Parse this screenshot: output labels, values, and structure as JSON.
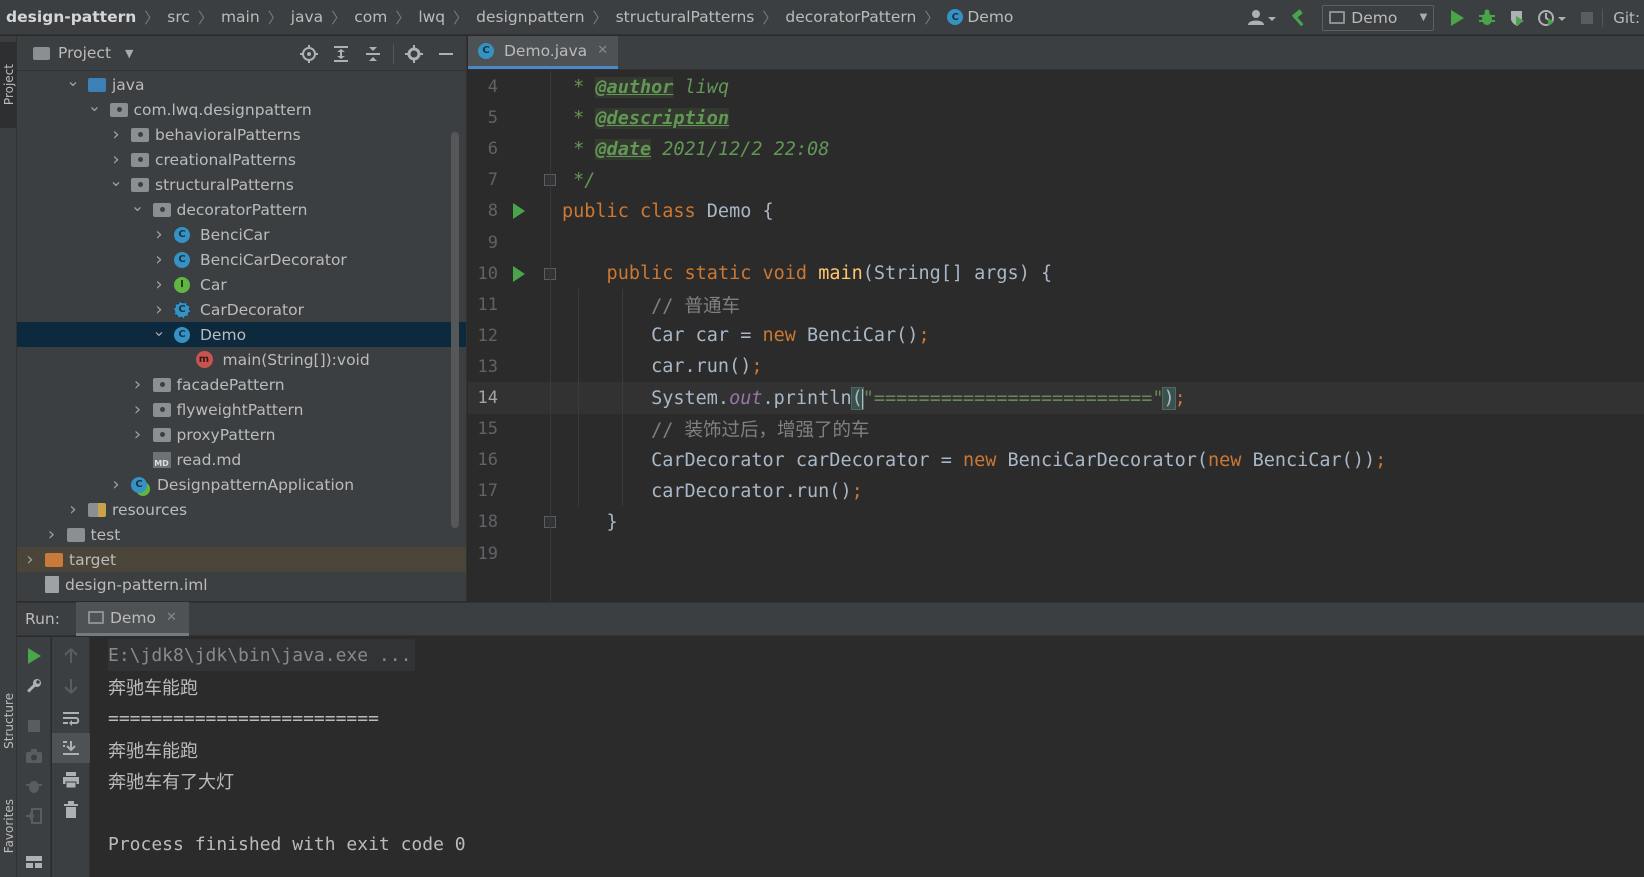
{
  "breadcrumb": [
    {
      "label": "design-pattern"
    },
    {
      "label": "src"
    },
    {
      "label": "main"
    },
    {
      "label": "java"
    },
    {
      "label": "com"
    },
    {
      "label": "lwq"
    },
    {
      "label": "designpattern"
    },
    {
      "label": "structuralPatterns"
    },
    {
      "label": "decoratorPattern"
    },
    {
      "label": "Demo"
    }
  ],
  "toolbar": {
    "run_config": "Demo",
    "git_label": "Git:"
  },
  "left_stripe": {
    "project": "Project",
    "structure": "Structure",
    "favorites": "Favorites"
  },
  "project_panel": {
    "title": "Project",
    "tree": [
      {
        "label": "java",
        "depth": 3,
        "expanded": true,
        "icon": "folder-blue-icon"
      },
      {
        "label": "com.lwq.designpattern",
        "depth": 4,
        "expanded": true,
        "icon": "package-icon"
      },
      {
        "label": "behavioralPatterns",
        "depth": 5,
        "expanded": false,
        "icon": "package-icon"
      },
      {
        "label": "creationalPatterns",
        "depth": 5,
        "expanded": false,
        "icon": "package-icon"
      },
      {
        "label": "structuralPatterns",
        "depth": 5,
        "expanded": true,
        "icon": "package-icon"
      },
      {
        "label": "decoratorPattern",
        "depth": 6,
        "expanded": true,
        "icon": "package-icon"
      },
      {
        "label": "BenciCar",
        "depth": 7,
        "expanded": false,
        "icon": "class-icon"
      },
      {
        "label": "BenciCarDecorator",
        "depth": 7,
        "expanded": false,
        "icon": "class-icon"
      },
      {
        "label": "Car",
        "depth": 7,
        "expanded": false,
        "icon": "interface-icon"
      },
      {
        "label": "CarDecorator",
        "depth": 7,
        "expanded": false,
        "icon": "abstract-class-icon"
      },
      {
        "label": "Demo",
        "depth": 7,
        "expanded": true,
        "icon": "class-icon",
        "selected": true
      },
      {
        "label": "main(String[]):void",
        "depth": 8,
        "icon": "method-icon"
      },
      {
        "label": "facadePattern",
        "depth": 6,
        "expanded": false,
        "icon": "package-icon"
      },
      {
        "label": "flyweightPattern",
        "depth": 6,
        "expanded": false,
        "icon": "package-icon"
      },
      {
        "label": "proxyPattern",
        "depth": 6,
        "expanded": false,
        "icon": "package-icon"
      },
      {
        "label": "read.md",
        "depth": 6,
        "icon": "markdown-icon"
      },
      {
        "label": "DesignpatternApplication",
        "depth": 5,
        "expanded": false,
        "icon": "spring-class-icon"
      },
      {
        "label": "resources",
        "depth": 3,
        "expanded": false,
        "icon": "resources-folder-icon"
      },
      {
        "label": "test",
        "depth": 2,
        "expanded": false,
        "icon": "folder-icon"
      },
      {
        "label": "target",
        "depth": 1,
        "expanded": false,
        "icon": "folder-orange-icon",
        "excluded": true
      },
      {
        "label": "design-pattern.iml",
        "depth": 1,
        "icon": "iml-file-icon"
      }
    ]
  },
  "editor": {
    "tab_label": "Demo.java",
    "current_line": 14,
    "lines": [
      {
        "num": "4",
        "parts": [
          [
            " * ",
            "doc"
          ],
          [
            "@author",
            "tag"
          ],
          [
            " liwq",
            "doc"
          ]
        ]
      },
      {
        "num": "5",
        "parts": [
          [
            " * ",
            "doc"
          ],
          [
            "@description",
            "tag"
          ]
        ]
      },
      {
        "num": "6",
        "parts": [
          [
            " * ",
            "doc"
          ],
          [
            "@date",
            "tag"
          ],
          [
            " 2021/12/2 22:08",
            "doc"
          ]
        ]
      },
      {
        "num": "7",
        "parts": [
          [
            " */",
            "doc"
          ]
        ],
        "fold": true
      },
      {
        "num": "8",
        "parts": [
          [
            "public ",
            "kw"
          ],
          [
            "class ",
            "kw"
          ],
          [
            "Demo ",
            "txt"
          ],
          [
            "{",
            "txt"
          ]
        ],
        "run": true
      },
      {
        "num": "9",
        "parts": []
      },
      {
        "num": "10",
        "parts": [
          [
            "    public ",
            "kw"
          ],
          [
            "static ",
            "kw"
          ],
          [
            "void ",
            "kw"
          ],
          [
            "main",
            "fn"
          ],
          [
            "(String[] args) {",
            "txt"
          ]
        ],
        "run": true,
        "fold": true
      },
      {
        "num": "11",
        "parts": [
          [
            "        // 普通车",
            "lc"
          ]
        ]
      },
      {
        "num": "12",
        "parts": [
          [
            "        Car car = ",
            "txt"
          ],
          [
            "new ",
            "kw"
          ],
          [
            "BenciCar()",
            "txt"
          ],
          [
            ";",
            "semi"
          ]
        ]
      },
      {
        "num": "13",
        "parts": [
          [
            "        car.run()",
            "txt"
          ],
          [
            ";",
            "semi"
          ]
        ]
      },
      {
        "num": "14",
        "parts": [
          [
            "        System.",
            "txt"
          ],
          [
            "out",
            "field"
          ],
          [
            ".println",
            "txt"
          ],
          [
            "(",
            "brace"
          ],
          [
            "CARET",
            "caret"
          ],
          [
            "\"=========================\"",
            "str"
          ],
          [
            ")",
            "brace"
          ],
          [
            ";",
            "semi"
          ]
        ]
      },
      {
        "num": "15",
        "parts": [
          [
            "        // 装饰过后，增强了的车",
            "lc"
          ]
        ]
      },
      {
        "num": "16",
        "parts": [
          [
            "        CarDecorator carDecorator = ",
            "txt"
          ],
          [
            "new ",
            "kw"
          ],
          [
            "BenciCarDecorator(",
            "txt"
          ],
          [
            "new ",
            "kw"
          ],
          [
            "BenciCar())",
            "txt"
          ],
          [
            ";",
            "semi"
          ]
        ]
      },
      {
        "num": "17",
        "parts": [
          [
            "        carDecorator.run()",
            "txt"
          ],
          [
            ";",
            "semi"
          ]
        ]
      },
      {
        "num": "18",
        "parts": [
          [
            "    }",
            "txt"
          ]
        ],
        "fold": true
      },
      {
        "num": "19",
        "parts": []
      }
    ]
  },
  "run_panel": {
    "label": "Run:",
    "tab_label": "Demo",
    "console": [
      {
        "text": "E:\\jdk8\\jdk\\bin\\java.exe ...",
        "kind": "cmd"
      },
      {
        "text": "奔驰车能跑",
        "kind": "out"
      },
      {
        "text": "=========================",
        "kind": "out"
      },
      {
        "text": "奔驰车能跑",
        "kind": "out"
      },
      {
        "text": "奔驰车有了大灯",
        "kind": "out"
      },
      {
        "text": "",
        "kind": "out"
      },
      {
        "text": "Process finished with exit code 0",
        "kind": "out"
      }
    ]
  },
  "colors": {
    "accent_tab": "#4a88c7",
    "selection": "#0d293e",
    "run_green": "#4aa54a"
  }
}
